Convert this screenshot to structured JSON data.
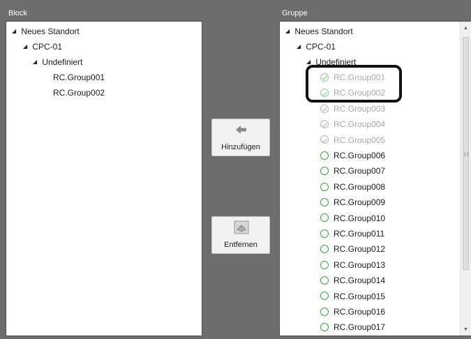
{
  "block": {
    "header": "Block",
    "tree": {
      "root": "Neues Standort",
      "controller": "CPC-01",
      "folder": "Undefiniert",
      "items": [
        "RC.Group001",
        "RC.Group002"
      ]
    }
  },
  "gruppe": {
    "header": "Gruppe",
    "tree": {
      "root": "Neues Standort",
      "controller": "CPC-01",
      "folder": "Undefiniert",
      "items": [
        {
          "label": "RC.Group001",
          "state": "selected",
          "icon": "check-circle-green-icon"
        },
        {
          "label": "RC.Group002",
          "state": "selected",
          "icon": "check-circle-green-icon"
        },
        {
          "label": "RC.Group003",
          "state": "disabled",
          "icon": "check-circle-grey-icon"
        },
        {
          "label": "RC.Group004",
          "state": "disabled",
          "icon": "check-circle-grey-icon"
        },
        {
          "label": "RC.Group005",
          "state": "disabled",
          "icon": "check-circle-grey-icon"
        },
        {
          "label": "RC.Group006",
          "state": "available",
          "icon": "circle-green-icon"
        },
        {
          "label": "RC.Group007",
          "state": "available",
          "icon": "circle-green-icon"
        },
        {
          "label": "RC.Group008",
          "state": "available",
          "icon": "circle-green-icon"
        },
        {
          "label": "RC.Group009",
          "state": "available",
          "icon": "circle-green-icon"
        },
        {
          "label": "RC.Group010",
          "state": "available",
          "icon": "circle-green-icon"
        },
        {
          "label": "RC.Group011",
          "state": "available",
          "icon": "circle-green-icon"
        },
        {
          "label": "RC.Group012",
          "state": "available",
          "icon": "circle-green-icon"
        },
        {
          "label": "RC.Group013",
          "state": "available",
          "icon": "circle-green-icon"
        },
        {
          "label": "RC.Group014",
          "state": "available",
          "icon": "circle-green-icon"
        },
        {
          "label": "RC.Group015",
          "state": "available",
          "icon": "circle-green-icon"
        },
        {
          "label": "RC.Group016",
          "state": "available",
          "icon": "circle-green-icon"
        },
        {
          "label": "RC.Group017",
          "state": "available",
          "icon": "circle-green-icon"
        }
      ]
    }
  },
  "buttons": {
    "add_label": "Hinzufügen",
    "add_icon": "arrow-left-icon",
    "remove_label": "Entfernen",
    "remove_icon": "remove-box-icon"
  },
  "colors": {
    "background": "#6d6d6d",
    "available_icon": "#33aa33",
    "selected_icon": "#8ed28e",
    "disabled_text": "#a8a8a8",
    "highlight": "#111111"
  }
}
